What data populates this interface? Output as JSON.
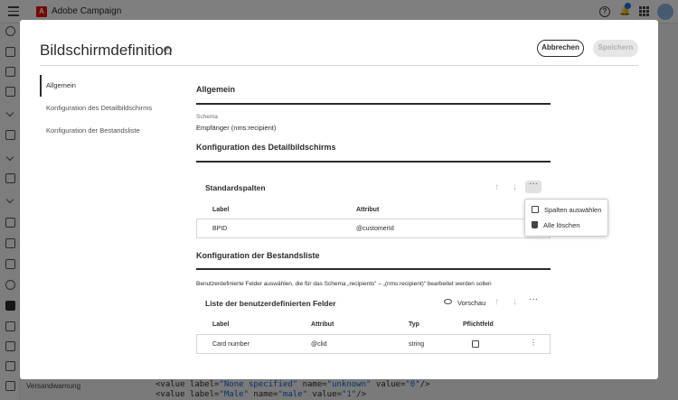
{
  "app": {
    "name": "Adobe Campaign"
  },
  "sidebar_bottom_label": "Versandwarnung",
  "background_code": [
    {
      "tag": "<value label=",
      "label": "\"None specified\"",
      "mid1": " name=",
      "name": "\"unknown\"",
      "mid2": " value=",
      "value": "\"0\"",
      "end": "/>"
    },
    {
      "tag": "<value label=",
      "label": "\"Male\"",
      "mid1": " name=",
      "name": "\"male\"",
      "mid2": " value=",
      "value": "\"1\"",
      "end": "/>"
    }
  ],
  "dialog": {
    "title": "Bildschirmdefinition",
    "cancel_label": "Abbrechen",
    "save_label": "Speichern",
    "nav": [
      {
        "label": "Allgemein"
      },
      {
        "label": "Konfiguration des Detailbildschirms"
      },
      {
        "label": "Konfiguration der Bestandsliste"
      }
    ],
    "general": {
      "heading": "Allgemein",
      "schema_label": "Schema",
      "schema_value": "Empfänger (nms:recipient)"
    },
    "detail": {
      "heading": "Konfiguration des Detailbildschirms",
      "panel_title": "Standardspalten",
      "columns": [
        "Label",
        "Attribut"
      ],
      "rows": [
        {
          "label": "BPID",
          "attribute": "@customerId"
        }
      ],
      "menu": [
        "Spalten auswählen",
        "Alle löschen"
      ]
    },
    "inventory": {
      "heading": "Konfiguration der Bestandsliste",
      "description": "Benutzerdefinierte Felder auswählen, die für das Schema „recipients“ – „(nms:recipient)“ bearbeitet werden sollen",
      "panel_title": "Liste der benutzerdefinierten Felder",
      "preview_label": "Vorschau",
      "columns": [
        "Label",
        "Attribut",
        "Typ",
        "Pflichtfeld"
      ],
      "rows": [
        {
          "label": "Card number",
          "attribute": "@clid",
          "type": "string",
          "required": false
        }
      ]
    }
  }
}
